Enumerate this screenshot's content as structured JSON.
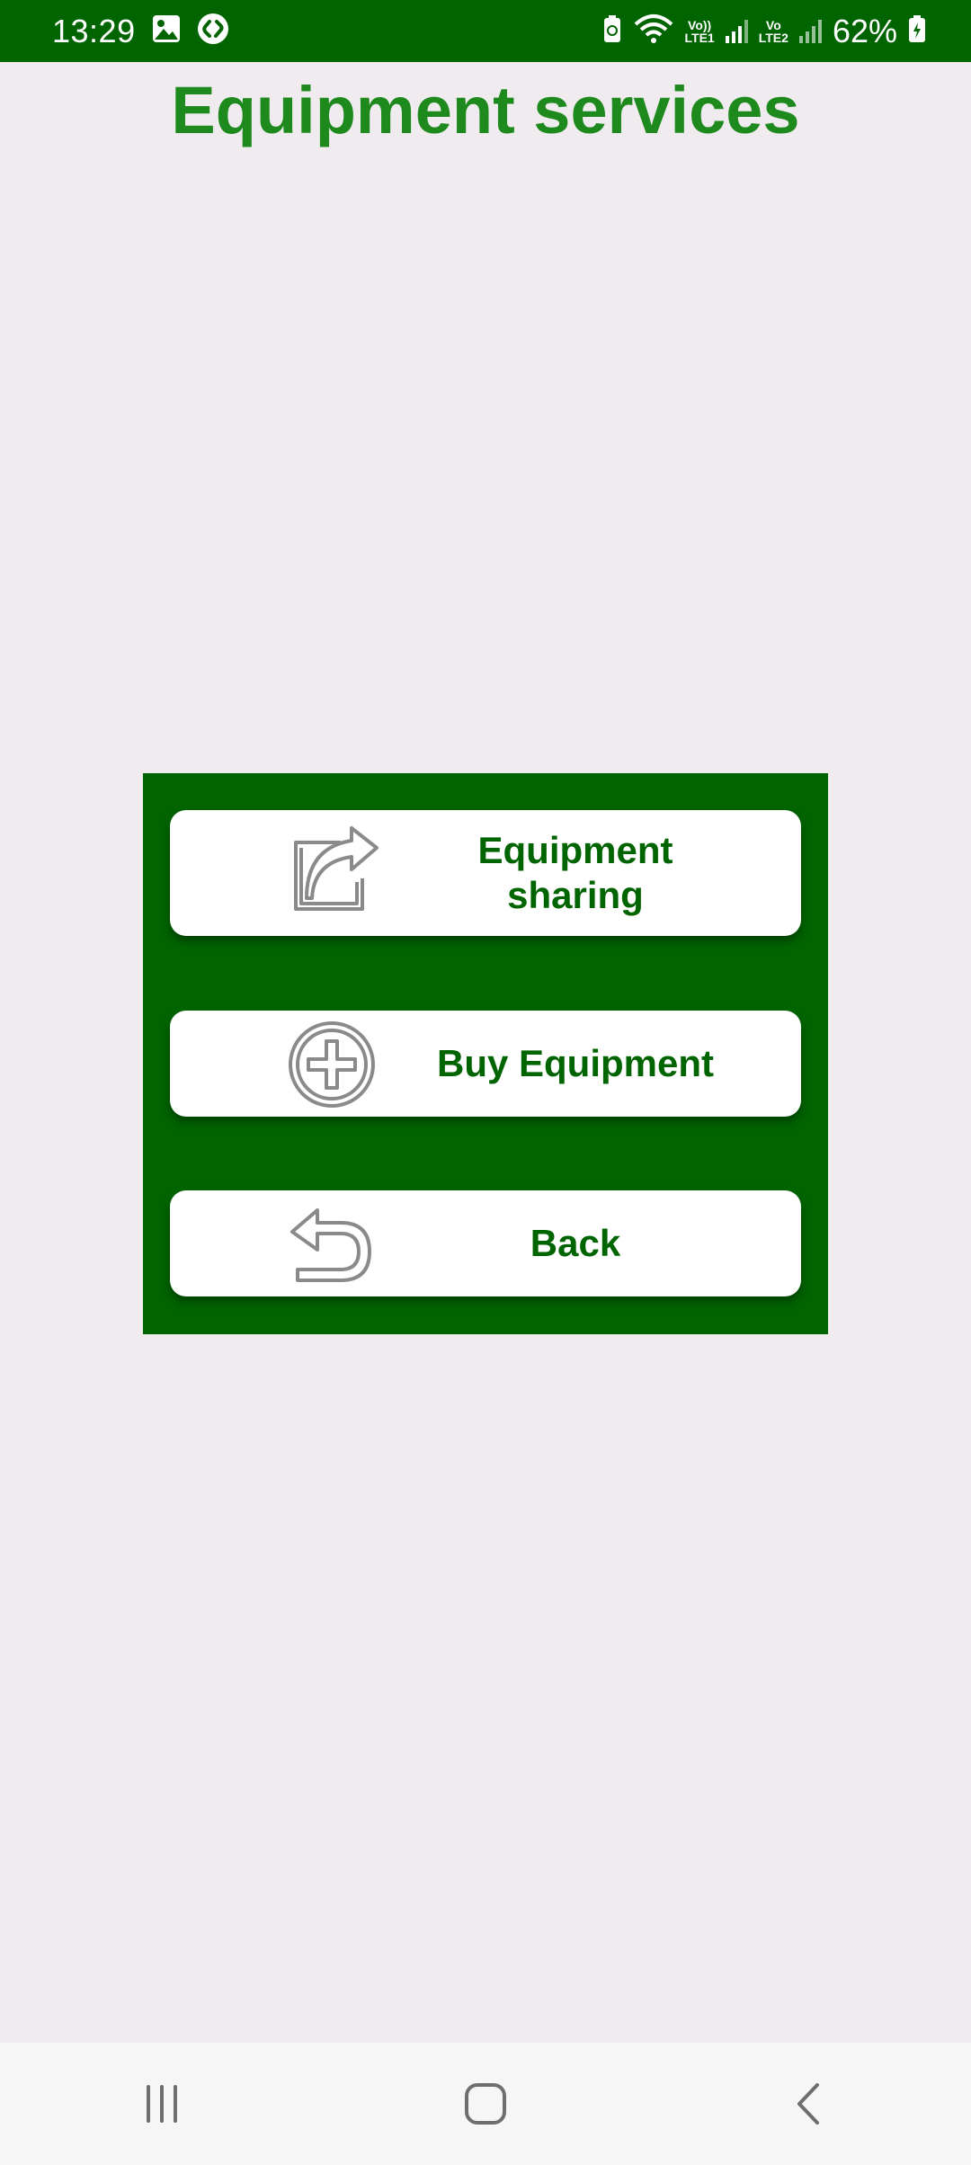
{
  "status_bar": {
    "time": "13:29",
    "network_label_1_top": "Vo))",
    "network_label_1_bottom": "LTE1",
    "network_label_2_top": "Vo",
    "network_label_2_bottom": "LTE2",
    "battery": "62%",
    "icons": [
      "image-icon",
      "shazam-icon",
      "battery-saver-icon",
      "wifi-icon",
      "signal-icon",
      "battery-icon"
    ]
  },
  "page": {
    "title": "Equipment services"
  },
  "menu": {
    "items": [
      {
        "label_line1": "Equipment",
        "label_line2": "sharing",
        "icon": "share-icon"
      },
      {
        "label": "Buy Equipment",
        "icon": "plus-circle-icon"
      },
      {
        "label": "Back",
        "icon": "back-arrow-icon"
      }
    ]
  },
  "nav": {
    "icons": [
      "recent-apps-icon",
      "home-icon",
      "back-icon"
    ]
  },
  "colors": {
    "primary_green": "#006400",
    "title_green": "#1e8a1e",
    "background": "#f0ebef",
    "button_bg": "#ffffff"
  }
}
